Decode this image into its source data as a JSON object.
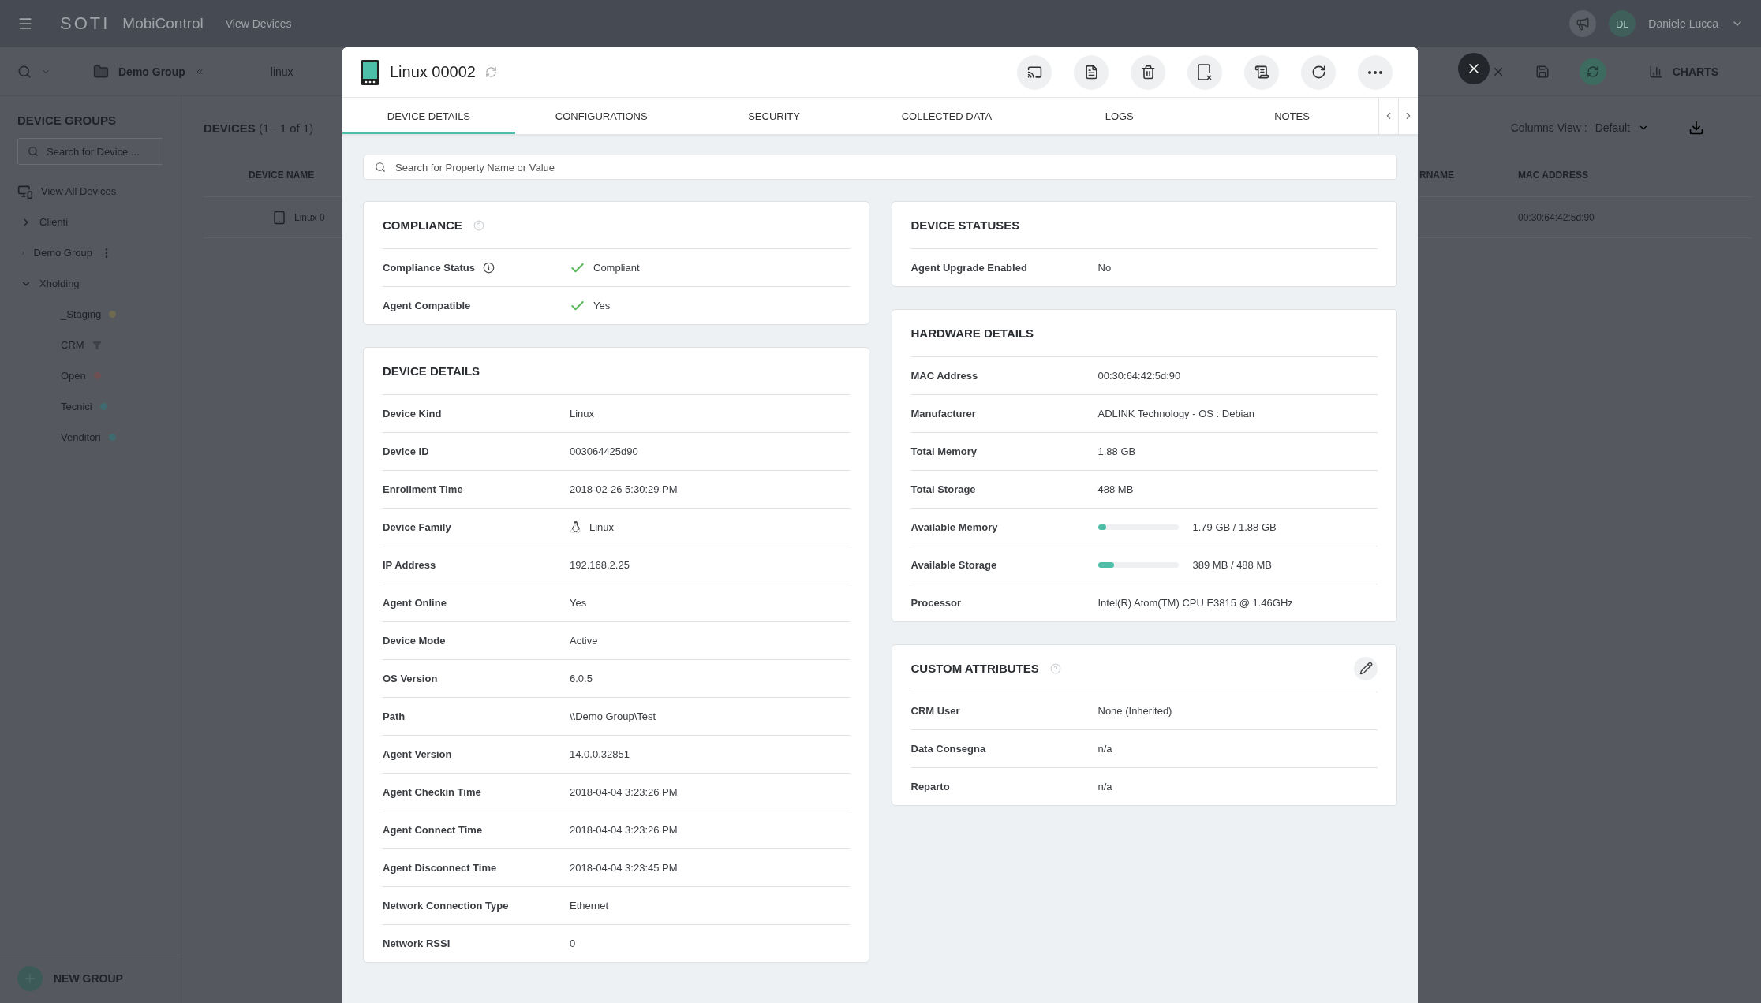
{
  "topbar": {
    "brand": "SOTI",
    "product": "MobiControl",
    "page": "View Devices",
    "avatar": "DL",
    "user": "Daniele Lucca"
  },
  "toolbar": {
    "group": "Demo Group",
    "filter": "linux",
    "charts": "CHARTS"
  },
  "sidebar": {
    "title": "DEVICE GROUPS",
    "search": {
      "placeholder": "Search for Device ..."
    },
    "view_all": "View All Devices",
    "groups": [
      {
        "label": "Clienti",
        "expanded": false
      },
      {
        "label": "Demo Group",
        "expanded": false
      },
      {
        "label": "Xholding",
        "expanded": true,
        "children": [
          {
            "label": "_Staging",
            "kind": "dot",
            "color": "#6e6a52"
          },
          {
            "label": "CRM",
            "kind": "filter"
          },
          {
            "label": "Open",
            "kind": "dot",
            "color": "#6e4f52"
          },
          {
            "label": "Tecnici",
            "kind": "dot",
            "color": "#3f6b70"
          },
          {
            "label": "Venditori",
            "kind": "dot",
            "color": "#3f6b70"
          }
        ]
      }
    ],
    "new_group": "NEW GROUP"
  },
  "devices": {
    "title": "DEVICES",
    "count": "(1 - 1 of 1)",
    "columns_view_label": "Columns View :",
    "columns_view": "Default",
    "columns": [
      "DEVICE NAME",
      "RNAME",
      "MAC ADDRESS"
    ],
    "row": {
      "name": "Linux 0",
      "mac": "00:30:64:42:5d:90"
    }
  },
  "modal": {
    "title": "Linux 00002",
    "tabs": [
      {
        "label": "DEVICE DETAILS",
        "selected": true
      },
      {
        "label": "CONFIGURATIONS",
        "selected": false
      },
      {
        "label": "SECURITY",
        "selected": false
      },
      {
        "label": "COLLECTED DATA",
        "selected": false
      },
      {
        "label": "LOGS",
        "selected": false
      },
      {
        "label": "NOTES",
        "selected": false
      }
    ],
    "search": {
      "placeholder": "Search for Property Name or Value"
    },
    "columns": [
      [
        {
          "title": "COMPLIANCE",
          "help": true,
          "editable": false,
          "rows": [
            {
              "label": "Compliance Status",
              "info": true,
              "kind": "check",
              "value": "Compliant"
            },
            {
              "label": "Agent Compatible",
              "info": false,
              "kind": "check",
              "value": "Yes"
            }
          ]
        },
        {
          "title": "DEVICE DETAILS",
          "help": false,
          "editable": false,
          "rows": [
            {
              "label": "Device Kind",
              "kind": "text",
              "value": "Linux"
            },
            {
              "label": "Device ID",
              "kind": "text",
              "value": "003064425d90"
            },
            {
              "label": "Enrollment Time",
              "kind": "text",
              "value": "2018-02-26 5:30:29 PM"
            },
            {
              "label": "Device Family",
              "kind": "linux",
              "value": "Linux"
            },
            {
              "label": "IP Address",
              "kind": "text",
              "value": "192.168.2.25"
            },
            {
              "label": "Agent Online",
              "kind": "text",
              "value": "Yes"
            },
            {
              "label": "Device Mode",
              "kind": "text",
              "value": "Active"
            },
            {
              "label": "OS Version",
              "kind": "text",
              "value": "6.0.5"
            },
            {
              "label": "Path",
              "kind": "text",
              "value": "\\\\Demo Group\\Test"
            },
            {
              "label": "Agent Version",
              "kind": "text",
              "value": "14.0.0.32851"
            },
            {
              "label": "Agent Checkin Time",
              "kind": "text",
              "value": "2018-04-04 3:23:26 PM"
            },
            {
              "label": "Agent Connect Time",
              "kind": "text",
              "value": "2018-04-04 3:23:26 PM"
            },
            {
              "label": "Agent Disconnect Time",
              "kind": "text",
              "value": "2018-04-04 3:23:45 PM"
            },
            {
              "label": "Network Connection Type",
              "kind": "text",
              "value": "Ethernet"
            },
            {
              "label": "Network RSSI",
              "kind": "text",
              "value": "0"
            }
          ]
        }
      ],
      [
        {
          "title": "DEVICE STATUSES",
          "help": false,
          "editable": false,
          "rows": [
            {
              "label": "Agent Upgrade Enabled",
              "kind": "text",
              "value": "No"
            }
          ]
        },
        {
          "title": "HARDWARE DETAILS",
          "help": false,
          "editable": false,
          "rows": [
            {
              "label": "MAC Address",
              "kind": "text",
              "value": "00:30:64:42:5d:90"
            },
            {
              "label": "Manufacturer",
              "kind": "text",
              "value": "ADLINK Technology - OS : Debian"
            },
            {
              "label": "Total Memory",
              "kind": "text",
              "value": "1.88 GB"
            },
            {
              "label": "Total Storage",
              "kind": "text",
              "value": "488 MB"
            },
            {
              "label": "Available Memory",
              "kind": "meter",
              "level": 0.1,
              "value": "1.79 GB / 1.88 GB"
            },
            {
              "label": "Available Storage",
              "kind": "meter",
              "level": 0.2,
              "value": "389 MB / 488 MB"
            },
            {
              "label": "Processor",
              "kind": "text",
              "value": "Intel(R) Atom(TM) CPU E3815 @ 1.46GHz"
            }
          ]
        },
        {
          "title": "CUSTOM ATTRIBUTES",
          "help": true,
          "editable": true,
          "rows": [
            {
              "label": "CRM User",
              "kind": "text",
              "value": "None (Inherited)"
            },
            {
              "label": "Data Consegna",
              "kind": "text",
              "value": "n/a"
            },
            {
              "label": "Reparto",
              "kind": "text",
              "value": "n/a"
            }
          ]
        }
      ]
    ]
  }
}
